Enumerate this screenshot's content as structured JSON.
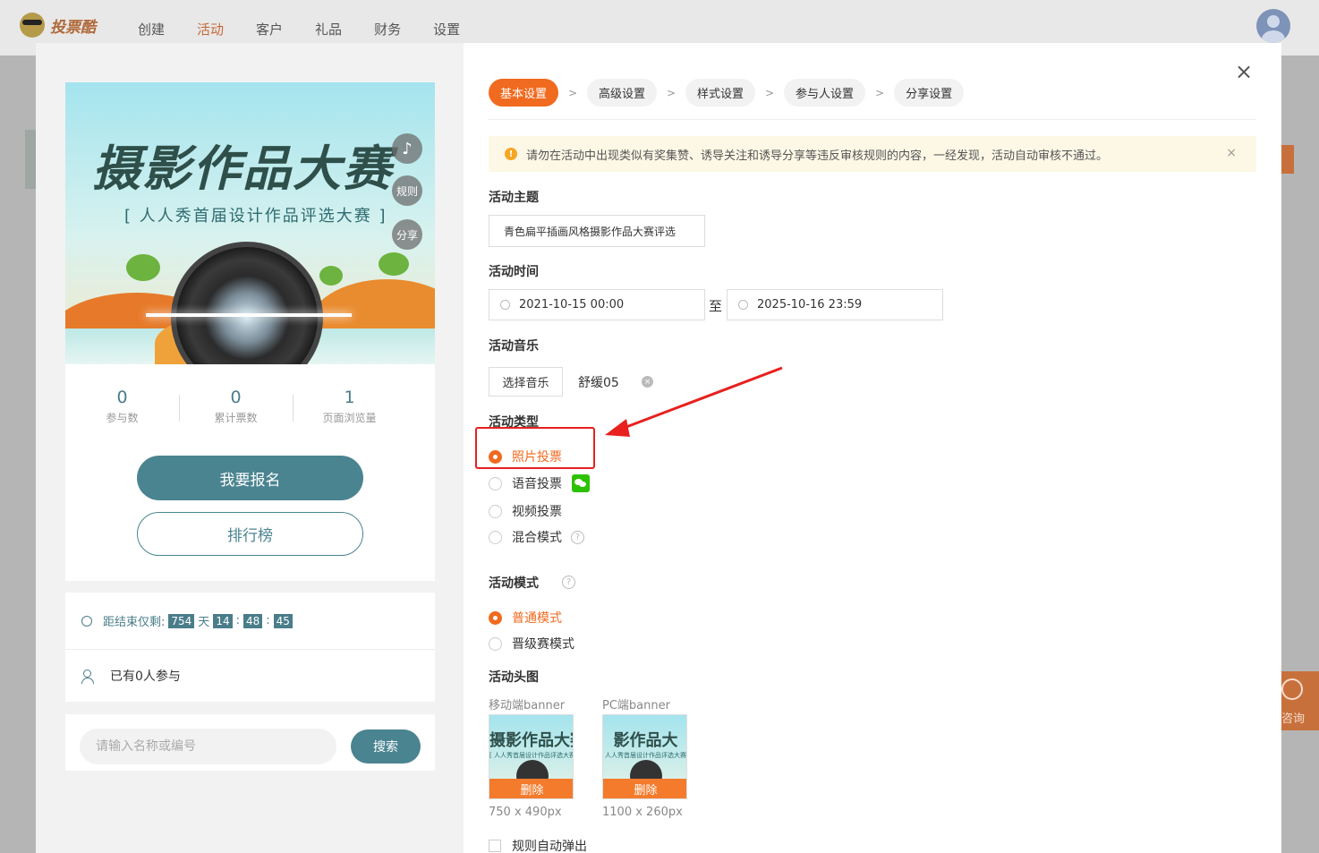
{
  "topnav": {
    "brand": "投票酷",
    "menu": [
      {
        "label": "创建",
        "active": false
      },
      {
        "label": "活动",
        "active": true
      },
      {
        "label": "客户",
        "active": false
      },
      {
        "label": "礼品",
        "active": false
      },
      {
        "label": "财务",
        "active": false
      },
      {
        "label": "设置",
        "active": false
      }
    ]
  },
  "consult": {
    "label": "咨询"
  },
  "preview": {
    "banner": {
      "title": "摄影作品大赛",
      "subtitle": "[ 人人秀首届设计作品评选大赛 ]",
      "fab_music": "♪",
      "fab_rules": "规则",
      "fab_share": "分享"
    },
    "stats": [
      {
        "value": "0",
        "label": "参与数"
      },
      {
        "value": "0",
        "label": "累计票数"
      },
      {
        "value": "1",
        "label": "页面浏览量"
      }
    ],
    "signup_label": "我要报名",
    "rank_label": "排行榜",
    "countdown": {
      "prefix": "距结束仅剩:",
      "days": "754",
      "days_unit": "天",
      "hours": "14",
      "minutes": "48",
      "seconds": "45",
      "sep": ":"
    },
    "participants_text": "已有0人参与",
    "search": {
      "placeholder": "请输入名称或编号",
      "button": "搜索"
    }
  },
  "steps": [
    {
      "label": "基本设置",
      "active": true
    },
    {
      "label": "高级设置",
      "active": false
    },
    {
      "label": "样式设置",
      "active": false
    },
    {
      "label": "参与人设置",
      "active": false
    },
    {
      "label": "分享设置",
      "active": false
    }
  ],
  "step_sep": ">",
  "close_icon": "×",
  "notice": {
    "icon": "!",
    "text": "请勿在活动中出现类似有奖集赞、诱导关注和诱导分享等违反审核规则的内容，一经发现，活动自动审核不通过。",
    "close": "×"
  },
  "form": {
    "theme_label": "活动主题",
    "theme_value": "青色扁平插画风格摄影作品大赛评选",
    "time_label": "活动时间",
    "start_time": "2021-10-15 00:00",
    "time_sep": "至",
    "end_time": "2025-10-16 23:59",
    "music_label": "活动音乐",
    "music_button": "选择音乐",
    "music_name": "舒缓05",
    "music_remove": "×",
    "type_label": "活动类型",
    "type_options": [
      {
        "label": "照片投票",
        "selected": true
      },
      {
        "label": "语音投票",
        "selected": false
      },
      {
        "label": "视频投票",
        "selected": false
      },
      {
        "label": "混合模式",
        "selected": false
      }
    ],
    "mode_label": "活动模式",
    "help_icon": "?",
    "mode_options": [
      {
        "label": "普通模式",
        "selected": true
      },
      {
        "label": "晋级赛模式",
        "selected": false
      }
    ],
    "header_label": "活动头图",
    "mobile_banner": {
      "label": "移动端banner",
      "thumb_title": "摄影作品大赛",
      "thumb_subtitle": "[ 人人秀首届设计作品评选大赛 ]",
      "delete": "删除",
      "size": "750 x 490px"
    },
    "pc_banner": {
      "label": "PC端banner",
      "thumb_title": "影作品大",
      "thumb_subtitle": "人人秀首届设计作品评选大赛",
      "delete": "删除",
      "size": "1100 x 260px"
    },
    "auto_popup_label": "规则自动弹出"
  },
  "annotation": {
    "color": "#e8201e"
  }
}
